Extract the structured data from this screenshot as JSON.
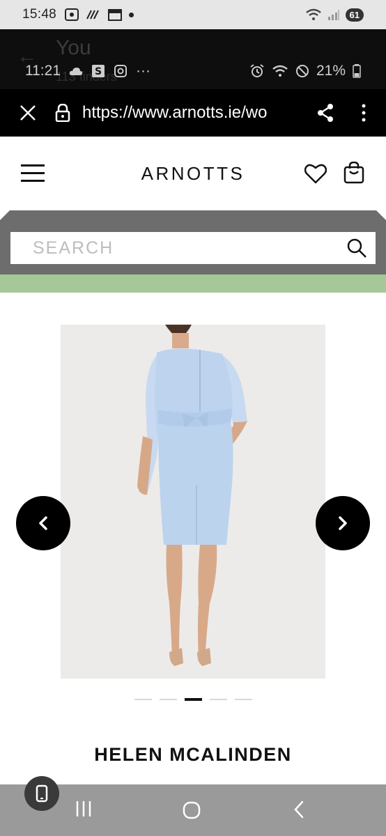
{
  "outer_status": {
    "time": "15:48",
    "battery": "61",
    "icons": [
      "screenshot-icon",
      "wifi-calling-icon",
      "calendar-icon",
      "dot-icon"
    ]
  },
  "inner_status": {
    "time": "11:21",
    "battery_percent": "21%",
    "more": "···",
    "ghost_title": "You",
    "ghost_subtitle": "113 finders"
  },
  "browser": {
    "url": "https://www.arnotts.ie/wo"
  },
  "site": {
    "brand": "ARNOTTS",
    "search_placeholder": "SEARCH"
  },
  "product": {
    "brand": "HELEN MCALINDEN",
    "image_alt": "Light blue fitted knee-length dress with belt, back view",
    "carousel": {
      "total": 5,
      "active": 3
    }
  },
  "colors": {
    "promo_strip": "#a6c898",
    "dress": "#bcd3ee",
    "search_band": "#6d6d6d"
  }
}
